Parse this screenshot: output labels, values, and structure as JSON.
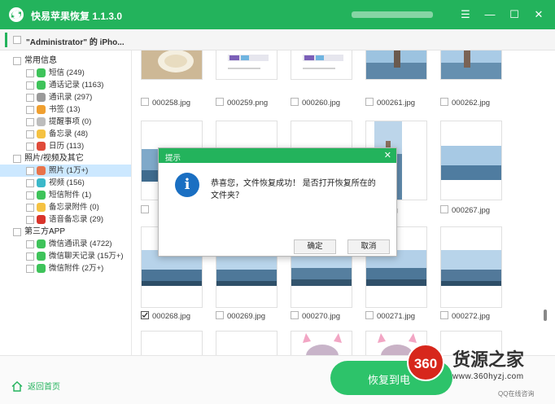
{
  "app": {
    "title": "快易苹果恢复 1.1.3.0",
    "window_controls": {
      "menu": "☰",
      "minimize": "—",
      "maximize": "☐",
      "close": "✕"
    }
  },
  "device": {
    "name": "\"Administrator\" 的 iPho..."
  },
  "sidebar": {
    "categories": [
      {
        "label": "常用信息",
        "items": [
          {
            "label": "短信 (249)",
            "icon": "sms-icon",
            "color": "#3ec35a"
          },
          {
            "label": "通话记录 (1163)",
            "icon": "phone-icon",
            "color": "#3ec35a"
          },
          {
            "label": "通讯录 (297)",
            "icon": "contacts-icon",
            "color": "#9a9a9a"
          },
          {
            "label": "书签 (13)",
            "icon": "bookmark-icon",
            "color": "#f0a030"
          },
          {
            "label": "提醒事项 (0)",
            "icon": "reminder-icon",
            "color": "#bdbdbd"
          },
          {
            "label": "备忘录 (48)",
            "icon": "notes-icon",
            "color": "#f5c242"
          },
          {
            "label": "日历 (113)",
            "icon": "calendar-icon",
            "color": "#e04b3a"
          }
        ]
      },
      {
        "label": "照片/视频及其它",
        "items": [
          {
            "label": "照片 (1万+)",
            "icon": "photos-icon",
            "color": "#e8734a",
            "selected": true
          },
          {
            "label": "视频 (156)",
            "icon": "video-icon",
            "color": "#3bb8c9"
          },
          {
            "label": "短信附件 (1)",
            "icon": "sms-attachment-icon",
            "color": "#3ec35a"
          },
          {
            "label": "备忘录附件 (0)",
            "icon": "notes-attachment-icon",
            "color": "#f5c242"
          },
          {
            "label": "语音备忘录 (29)",
            "icon": "voice-memo-icon",
            "color": "#d9342b"
          }
        ]
      },
      {
        "label": "第三方APP",
        "items": [
          {
            "label": "微信通讯录 (4722)",
            "icon": "wechat-icon",
            "color": "#3ec35a"
          },
          {
            "label": "微信聊天记录 (15万+)",
            "icon": "wechat-icon",
            "color": "#3ec35a"
          },
          {
            "label": "微信附件 (2万+)",
            "icon": "wechat-icon",
            "color": "#3ec35a"
          }
        ]
      }
    ]
  },
  "gallery": {
    "rows": [
      {
        "captions": [
          "000258.jpg",
          "000259.png",
          "000260.jpg",
          "000261.jpg",
          "000262.jpg"
        ]
      },
      {
        "captions": [
          "",
          "",
          "",
          "56.jpg",
          "000267.jpg"
        ]
      },
      {
        "captions": [
          "000268.jpg",
          "000269.jpg",
          "000270.jpg",
          "000271.jpg",
          "000272.jpg"
        ],
        "checked": [
          true,
          false,
          false,
          false,
          false
        ]
      }
    ]
  },
  "dialog": {
    "title": "提示",
    "close": "✕",
    "icon": "info-icon",
    "info_glyph": "i",
    "message": "恭喜您，文件恢复成功！ 是否打开恢复所在的文件夹？",
    "ok_label": "确定",
    "cancel_label": "取消"
  },
  "footer": {
    "home_label": "返回首页",
    "recover_label": "恢复到电"
  },
  "watermark": {
    "logo_text": "360",
    "title": "货源之家",
    "url": "www.360hyzj.com",
    "qq": "QQ在线咨询"
  },
  "colors": {
    "brand_green": "#23b35c",
    "button_green": "#2dc36a",
    "selected_row": "#cce8ff",
    "info_blue": "#1a6fc2",
    "watermark_red": "#d7271c"
  }
}
